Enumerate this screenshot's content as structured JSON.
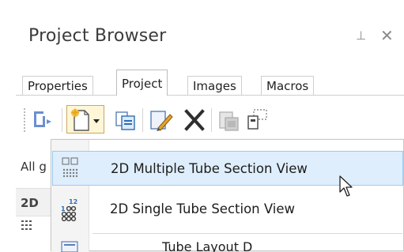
{
  "panel": {
    "title": "Project Browser",
    "pin_glyph": "⊥",
    "close_glyph": "✕"
  },
  "tabs": [
    {
      "label": "Properties",
      "active": false
    },
    {
      "label": "Project",
      "active": true
    },
    {
      "label": "Images",
      "active": false
    },
    {
      "label": "Macros",
      "active": false
    }
  ],
  "toolbar": {
    "buttons": [
      "connector-icon",
      "new-dropdown-icon",
      "copy-icon",
      "edit-icon",
      "delete-icon",
      "paste-disabled-icon",
      "select-region-icon"
    ]
  },
  "tree": {
    "row1_label": "All g",
    "row2_label": "2D"
  },
  "menu": {
    "items": [
      {
        "label": "2D Multiple Tube Section View",
        "icon": "multi-tube-grid-icon",
        "highlighted": true
      },
      {
        "label": "2D Single Tube Section View",
        "icon": "single-tube-numbered-icon",
        "highlighted": false
      },
      {
        "label": "Tube Layout D",
        "icon": "tube-layout-icon",
        "highlighted": false
      }
    ]
  },
  "colors": {
    "highlight_bg": "#dfeefc",
    "highlight_border": "#9ccaf2",
    "icon_blue": "#2a6fb7",
    "icon_gold": "#e2a52a",
    "delete_dark": "#2f2f2f"
  }
}
